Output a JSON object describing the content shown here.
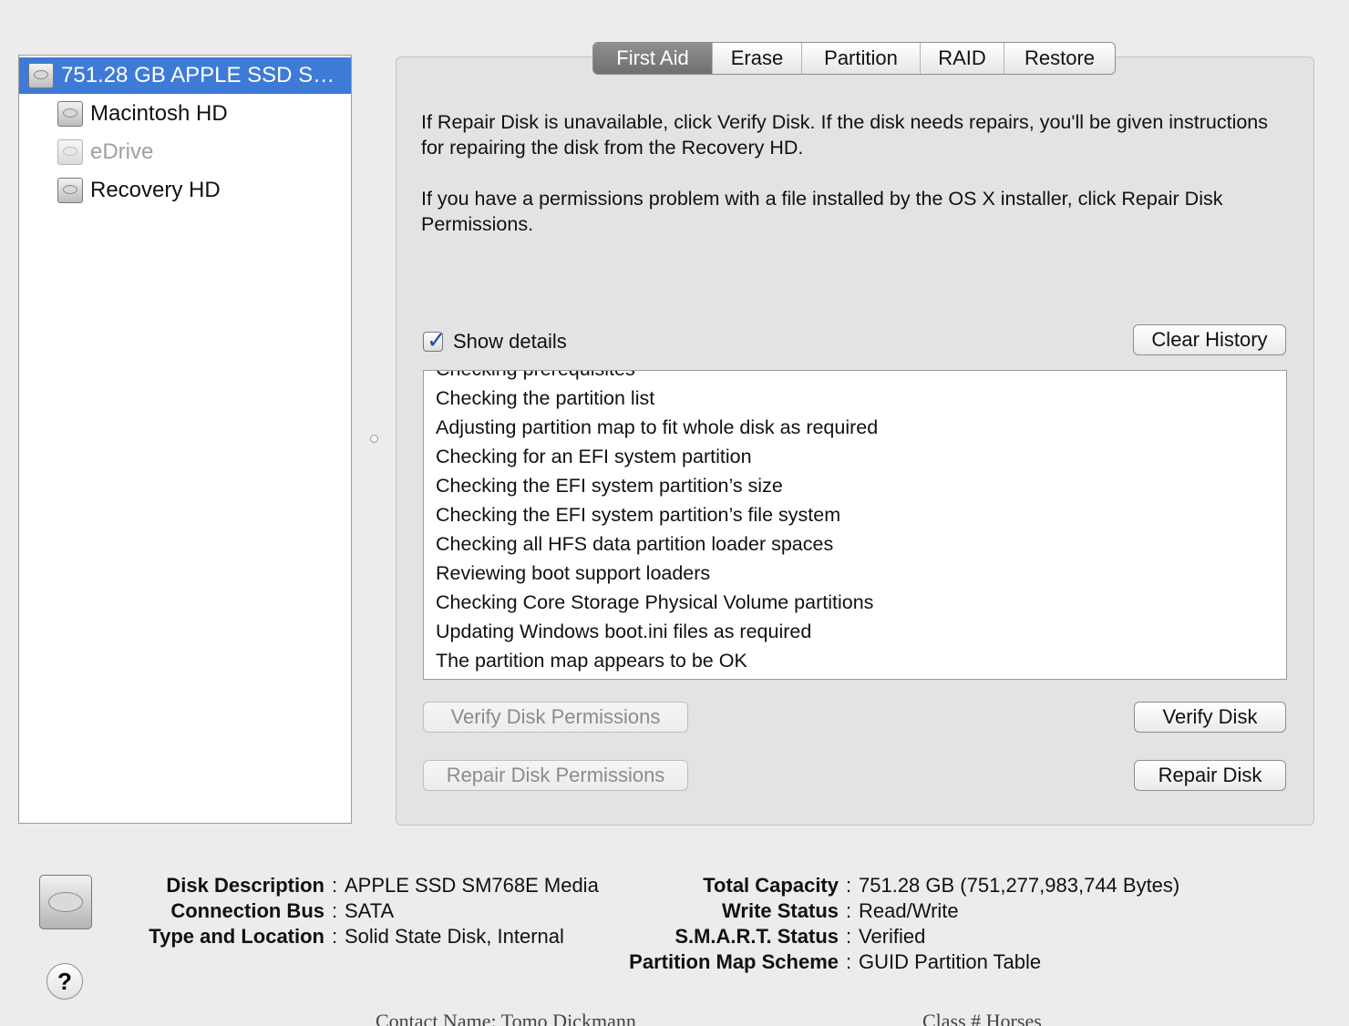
{
  "sidebar": {
    "items": [
      {
        "label": "751.28 GB APPLE SSD S…",
        "state": "selected",
        "icon": "hard-disk-icon"
      },
      {
        "label": "Macintosh HD",
        "state": "normal",
        "icon": "volume-icon"
      },
      {
        "label": "eDrive",
        "state": "dimmed",
        "icon": "volume-icon"
      },
      {
        "label": "Recovery HD",
        "state": "normal",
        "icon": "volume-icon"
      }
    ]
  },
  "tabs": [
    {
      "label": "First Aid",
      "active": true
    },
    {
      "label": "Erase",
      "active": false
    },
    {
      "label": "Partition",
      "active": false
    },
    {
      "label": "RAID",
      "active": false
    },
    {
      "label": "Restore",
      "active": false
    }
  ],
  "first_aid": {
    "info_paragraph_1": "If Repair Disk is unavailable, click Verify Disk. If the disk needs repairs, you'll be given instructions for repairing the disk from the Recovery HD.",
    "info_paragraph_2": "If you have a permissions problem with a file installed by the OS X installer, click Repair Disk Permissions.",
    "show_details_label": "Show details",
    "show_details_checked": true,
    "clear_history_label": "Clear History",
    "log_lines": [
      "Checking prerequisites",
      "Checking the partition list",
      "Adjusting partition map to fit whole disk as required",
      "Checking for an EFI system partition",
      "Checking the EFI system partition’s size",
      "Checking the EFI system partition’s file system",
      "Checking all HFS data partition loader spaces",
      "Reviewing boot support loaders",
      "Checking Core Storage Physical Volume partitions",
      "Updating Windows boot.ini files as required",
      "The partition map appears to be OK"
    ],
    "verify_permissions_label": "Verify Disk Permissions",
    "repair_permissions_label": "Repair Disk Permissions",
    "verify_disk_label": "Verify Disk",
    "repair_disk_label": "Repair Disk"
  },
  "disk_info": {
    "left": [
      {
        "label": "Disk Description",
        "value": "APPLE SSD SM768E Media"
      },
      {
        "label": "Connection Bus",
        "value": "SATA"
      },
      {
        "label": "Type and Location",
        "value": "Solid State Disk, Internal"
      }
    ],
    "right": [
      {
        "label": "Total Capacity",
        "value": "751.28 GB (751,277,983,744 Bytes)"
      },
      {
        "label": "Write Status",
        "value": "Read/Write"
      },
      {
        "label": "S.M.A.R.T. Status",
        "value": "Verified"
      },
      {
        "label": "Partition Map Scheme",
        "value": "GUID Partition Table"
      }
    ],
    "colon": ":"
  },
  "help_label": "?",
  "background_peek": {
    "left": "Contact Name:  Tomo Dickmann",
    "right": "Class # Horses"
  },
  "colors": {
    "selection": "#3d7bd6",
    "active_tab": "#7f7f7f",
    "window_bg": "#ececec",
    "panel_bg": "#e3e3e3",
    "checkmark": "#1e4fa8"
  }
}
